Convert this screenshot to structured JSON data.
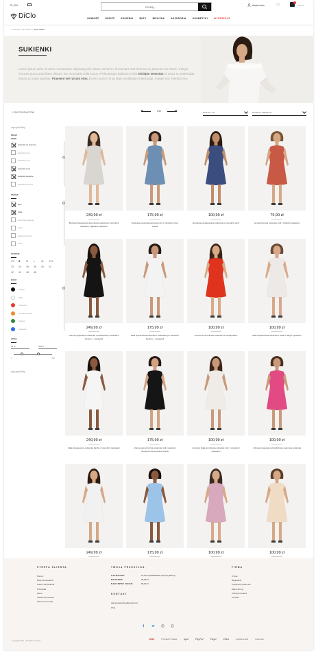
{
  "header": {
    "lang": "PL | EN",
    "logo": "DiClo",
    "search_placeholder": "szukaj...",
    "account": "twoje konto",
    "cart_total": "0,00 zł"
  },
  "nav": [
    "NOWOŚĆ",
    "ODZIEŻ",
    "SUKIENKI",
    "BUTY",
    "BIELIZNA",
    "AKCESORIA",
    "KOSMETYKI",
    "WYPRZEDAŻ"
  ],
  "breadcrumb": {
    "home": "STRONA GŁÓWNA",
    "sep": "»",
    "current": "SUKIENKI"
  },
  "hero": {
    "title": "SUKIENKI",
    "text_plain": "Lorem ipsum dolor sit amet, consectetur adipiscing elit. Etiam est lorem, fermentum sed rhoncus ut, pharetra non lorem. Integer rhoncus purus quis libero dictum, nec venenatis nulla luctus. Pellentesque habitant morbi ",
    "text_bold": "tristique senectus",
    "text_plain2": " et netus et malesuada fames ac turpis egestas. ",
    "text_bold2": "Praesent vel rutrum eros.",
    "text_plain3": " Donec auctor mi ac diam vestibulum malesuada. Integer nec interdum leo."
  },
  "toolbar": {
    "count": "1 390 PRODUKTÓW",
    "page": "1/56",
    "per_page": "POKAŻ: 20",
    "sort": "SORTUJ WEDŁUG"
  },
  "sidebar": {
    "clear": "wyczyść filtry",
    "fason_title": "fason",
    "fason": [
      {
        "label": "sukienki na imprezę",
        "on": true
      },
      {
        "label": "sukienki mini",
        "on": false
      },
      {
        "label": "sukienki midi",
        "on": false
      },
      {
        "label": "sukienki maxi",
        "on": true
      },
      {
        "label": "sukienki weselne",
        "on": true
      },
      {
        "label": "sukienki biurowe",
        "on": false
      }
    ],
    "marka_title": "marka",
    "marka": [
      {
        "label": "apis",
        "on": true
      },
      {
        "label": "ollea",
        "on": true
      },
      {
        "label": "american apparel",
        "on": false
      },
      {
        "label": "mmb",
        "on": false
      },
      {
        "label": "angel never sin",
        "on": false
      },
      {
        "label": "mexx",
        "on": false
      }
    ],
    "rozmiar_title": "rozmiar",
    "sizes": [
      "XS",
      "S",
      "M",
      "L",
      "XL",
      "XXL",
      "32",
      "34",
      "36",
      "38",
      "40",
      "42",
      "42",
      "44",
      "46",
      "48"
    ],
    "selected_size": "S",
    "kolor_title": "kolor",
    "colors": [
      {
        "label": "czarny",
        "hex": "#111111"
      },
      {
        "label": "biały",
        "hex": "#ffffff"
      },
      {
        "label": "czerwony",
        "hex": "#e03b2e"
      },
      {
        "label": "pomarańczowy",
        "hex": "#f08a2c"
      },
      {
        "label": "zielony",
        "hex": "#2f8a3c"
      },
      {
        "label": "niebieski",
        "hex": "#2c6fd8"
      }
    ],
    "cena_title": "cena",
    "price_from": "33 zł",
    "price_to": "326 zł",
    "price_sep": "-",
    "range_min": "0",
    "range_max": "500",
    "clear2": "wyczyść filtry"
  },
  "products": [
    {
      "price": "249,99 zł",
      "name": "Beżowa dopasowana koronkowa sukienka z szerokimi rękawami i głębokim dekoltem",
      "dress": "#d9d6d2",
      "skin": "#e0b99a",
      "hair": "#3a2a1f"
    },
    {
      "price": "175,99 zł",
      "name": "niebieska sukienka jeansowa mini z zamkiem przez środek",
      "dress": "#6d8fb3",
      "skin": "#c99a7a",
      "hair": "#2a1e17"
    },
    {
      "price": "100,99 zł",
      "name": "granatowa dopasowana sukienka w orientalny wzór",
      "dress": "#3b4d7e",
      "skin": "#c08e6a",
      "hair": "#2b1b12"
    },
    {
      "price": "79,99 zł",
      "name": "pomarańczowa sukienka midi z krótkimi rękawami",
      "dress": "#c85a45",
      "skin": "#d6a886",
      "hair": "#7a5634"
    },
    {
      "price": "249,99 zł",
      "name": "czarna prążkowana sukienka z kwadratowym dekoltem bodcon + mezgolod",
      "dress": "#141414",
      "skin": "#8a5a3e",
      "hair": "#1a120d"
    },
    {
      "price": "175,99 zł",
      "name": "biała prążkowana sukienka z kwadratowym dekoltem bodcon + mezgolod",
      "dress": "#f3f3f3",
      "skin": "#c9987a",
      "hair": "#231813"
    },
    {
      "price": "100,99 zł",
      "name": "czerwona koronkowa sukienka na ramiączkach",
      "dress": "#e0331e",
      "skin": "#d8aa86",
      "hair": "#3b2517"
    },
    {
      "price": "100,99 zł",
      "name": "biała dopasowana sukienka z siatki z długim rękawem",
      "dress": "#ede9e6",
      "skin": "#d7a98a",
      "hair": "#6b4a33"
    },
    {
      "price": "249,99 zł",
      "name": "biała dopasowana sukienka bardot z szerokimi rękawami",
      "dress": "#f5f5f5",
      "skin": "#8a5a3e",
      "hair": "#1a120d"
    },
    {
      "price": "175,99 zł",
      "name": "czarna asymetryczna sukienka midi na jednym ramiączku dla wysokich kobiet",
      "dress": "#151515",
      "skin": "#d2a283",
      "hair": "#231813"
    },
    {
      "price": "100,99 zł",
      "name": "premium biała koronkowa sukienka mini z szerokimi rękawami",
      "dress": "#efece8",
      "skin": "#c99a7a",
      "hair": "#3b2517"
    },
    {
      "price": "100,99 zł",
      "name": "różowa dopasowana bandażowa welurowa sukienka",
      "dress": "#e14a82",
      "skin": "#c99a7a",
      "hair": "#4b2f1f"
    },
    {
      "price": "249,99 zł",
      "name": "",
      "dress": "#f1f1f1",
      "skin": "#d6a886",
      "hair": "#2b1b12"
    },
    {
      "price": "175,99 zł",
      "name": "",
      "dress": "#9cc4e8",
      "skin": "#8a5a3e",
      "hair": "#1a120d"
    },
    {
      "price": "100,99 zł",
      "name": "",
      "dress": "#d8a8bc",
      "skin": "#d7a98a",
      "hair": "#3a2a1f"
    },
    {
      "price": "100,99 zł",
      "name": "",
      "dress": "#f0dcc5",
      "skin": "#d6a886",
      "hair": "#5b3c26"
    }
  ],
  "footer": {
    "client_title": "STREFA KLIENTA",
    "client_links": [
      "Pomoc",
      "Moje Zamówienia",
      "Status zamówienia",
      "Przesyłka",
      "Zwrot",
      "Tabela Rozmiarów",
      "Oferty I Promocje"
    ],
    "ship_title": "TWOJA PRZESYŁKA",
    "ship": [
      {
        "k": "STANDARD",
        "v": "15,99 zł (DARMOWA powyżej 250 zł)"
      },
      {
        "k": "EKSPRES",
        "v": "35,99 zł"
      },
      {
        "k": "NASTĘPNY DZIEŃ",
        "v": "65,99 zł"
      }
    ],
    "contact_title": "KONTAKT",
    "contact_email": "diamondsclothes@gmail.com",
    "faq": "FAQ",
    "company_title": "FIRMA",
    "company_links": [
      "O Nas",
      "Regulamin",
      "Polityka Prywatności",
      "Mapa Strony",
      "Polityka Cookies",
      "Kontakt"
    ],
    "copyright": "Copyright 2017 · All rights reserved",
    "partners": [
      "DHL",
      "Poczta Polska",
      "dpd",
      "PayPal",
      "PayU",
      "VISA",
      "mastercard",
      "maestro"
    ],
    "social": [
      "facebook",
      "twitter",
      "instagram",
      "pinterest"
    ]
  }
}
